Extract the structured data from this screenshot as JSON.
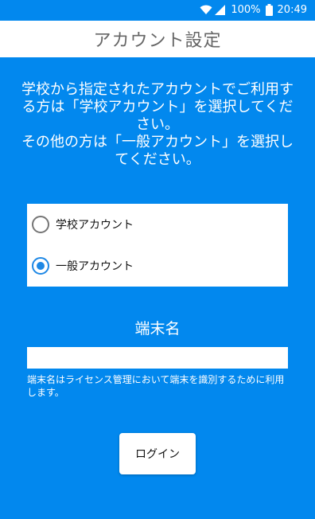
{
  "status_bar": {
    "battery": "100%",
    "time": "20:49",
    "icons": [
      "wifi-icon",
      "signal-icon",
      "battery-icon"
    ]
  },
  "header": {
    "title": "アカウント設定"
  },
  "instructions": {
    "line1": "学校から指定されたアカウントでご利用する方は「学校アカウント」を選択してください。",
    "line2": "その他の方は「一般アカウント」を選択してください。"
  },
  "account_type": {
    "options": [
      {
        "label": "学校アカウント",
        "selected": false
      },
      {
        "label": "一般アカウント",
        "selected": true
      }
    ]
  },
  "device": {
    "label": "端末名",
    "value": "",
    "helper": "端末名はライセンス管理において端末を識別するために利用します。"
  },
  "login": {
    "label": "ログイン"
  },
  "colors": {
    "background": "#0288ee",
    "radio_accent": "#1e88e5",
    "title_text": "#666666"
  }
}
